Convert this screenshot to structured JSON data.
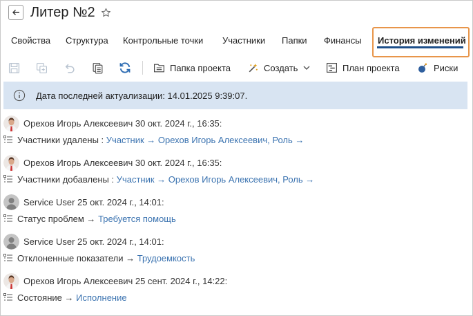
{
  "page": {
    "title": "Литер №2"
  },
  "tabs": [
    {
      "label": "Свойства"
    },
    {
      "label": "Структура"
    },
    {
      "label": "Контрольные точки"
    },
    {
      "label": "Участники"
    },
    {
      "label": "Папки"
    },
    {
      "label": "Финансы"
    },
    {
      "label": "История изменений",
      "active": true
    }
  ],
  "toolbar": {
    "project_folder": "Папка проекта",
    "create": "Создать",
    "project_plan": "План проекта",
    "risks": "Риски"
  },
  "info": {
    "text": "Дата последней актуализации: 14.01.2025 9:39:07."
  },
  "history": [
    {
      "author": "Орехов Игорь Алексеевич 30 окт. 2024 г., 16:35:",
      "avatar": "photo",
      "field": "Участники удалены :",
      "value": "Участник → Орехов Игорь Алексеевич, Роль →"
    },
    {
      "author": "Орехов Игорь Алексеевич 30 окт. 2024 г., 16:35:",
      "avatar": "photo",
      "field": "Участники добавлены :",
      "value": "Участник → Орехов Игорь Алексеевич, Роль →"
    },
    {
      "author": "Service User 25 окт. 2024 г., 14:01:",
      "avatar": "placeholder",
      "field": "Статус проблем →",
      "value": "Требуется помощь"
    },
    {
      "author": "Service User 25 окт. 2024 г., 14:01:",
      "avatar": "placeholder",
      "field": "Отклоненные показатели →",
      "value": "Трудоемкость"
    },
    {
      "author": "Орехов Игорь Алексеевич 25 сент. 2024 г., 14:22:",
      "avatar": "photo",
      "field": "Состояние →",
      "value": "Исполнение"
    }
  ],
  "colors": {
    "accent": "#1d4f8a",
    "highlight": "#e8954a",
    "info_bg": "#d8e4f2",
    "link": "#3b73b0"
  }
}
